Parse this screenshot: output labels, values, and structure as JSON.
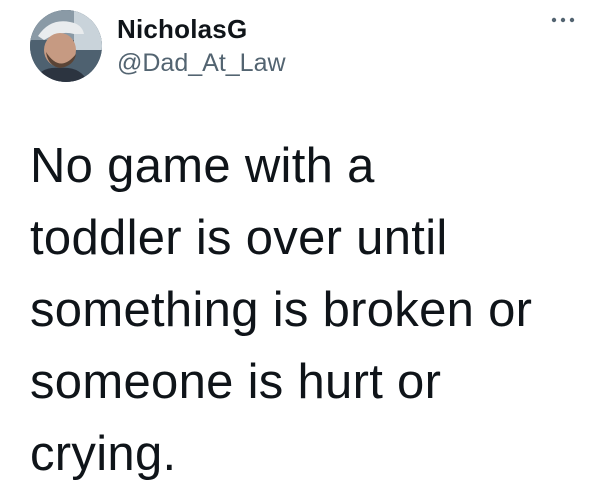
{
  "tweet": {
    "author": {
      "name": "NicholasG",
      "handle": "@Dad_At_Law",
      "avatar": "avatar-photo"
    },
    "more_icon": "more-horizontal-icon",
    "text": "No game with a\ntoddler is over until\nsomething is broken or\nsomeone is hurt or\ncrying."
  },
  "colors": {
    "text_primary": "#0f1419",
    "text_secondary": "#536471",
    "background": "#ffffff"
  }
}
